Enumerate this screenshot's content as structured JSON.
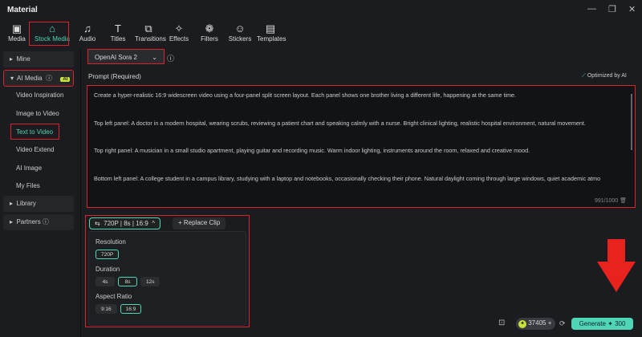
{
  "window": {
    "title": "Material",
    "minimize": "—",
    "restore": "❐",
    "close": "✕"
  },
  "tabs": [
    {
      "label": "Media",
      "icon": "▣"
    },
    {
      "label": "Stock Media",
      "icon": "⌂"
    },
    {
      "label": "Audio",
      "icon": "♫"
    },
    {
      "label": "Titles",
      "icon": "T"
    },
    {
      "label": "Transitions",
      "icon": "⧉"
    },
    {
      "label": "Effects",
      "icon": "✧"
    },
    {
      "label": "Filters",
      "icon": "❁"
    },
    {
      "label": "Stickers",
      "icon": "☺"
    },
    {
      "label": "Templates",
      "icon": "▤"
    }
  ],
  "sidebar": {
    "mine": "Mine",
    "ai_media": "AI Media",
    "ai_badge": "AI",
    "items": [
      "Video Inspiration",
      "Image to Video",
      "Text to Video",
      "Video Extend",
      "AI Image",
      "My Files"
    ],
    "library": "Library",
    "partners": "Partners"
  },
  "model": {
    "selected": "OpenAI Sora 2"
  },
  "prompt": {
    "label": "Prompt (Required)",
    "optimized": "Optimized by AI",
    "paragraphs": [
      "Create a hyper-realistic 16:9 widescreen video using a four-panel split screen layout. Each panel shows one brother living a different life, happening at the same time.",
      "Top left panel: A doctor in a modern hospital, wearing scrubs, reviewing a patient chart and speaking calmly with a nurse. Bright clinical lighting, realistic hospital environment, natural movement.",
      "Top right panel: A musician in a small studio apartment, playing guitar and recording music. Warm indoor lighting, instruments around the room, relaxed and creative mood.",
      "Bottom left panel: A college student in a campus library, studying with a laptop and notebooks, occasionally checking their phone. Natural daylight coming through large windows, quiet academic atmo"
    ],
    "count": "991/1000"
  },
  "settings": {
    "summary": {
      "res": "720P",
      "dur": "8s",
      "ratio": "16:9"
    },
    "replace": "Replace Clip",
    "resolution_label": "Resolution",
    "resolutions": [
      "720P"
    ],
    "duration_label": "Duration",
    "durations": [
      "4s",
      "8s",
      "12s"
    ],
    "ratio_label": "Aspect Ratio",
    "ratios": [
      "9:16",
      "16:9"
    ]
  },
  "footer": {
    "credits": "37405",
    "generate": "Generate",
    "cost": "300"
  },
  "colors": {
    "accent": "#4fd6b6",
    "highlight": "#d9232e"
  }
}
